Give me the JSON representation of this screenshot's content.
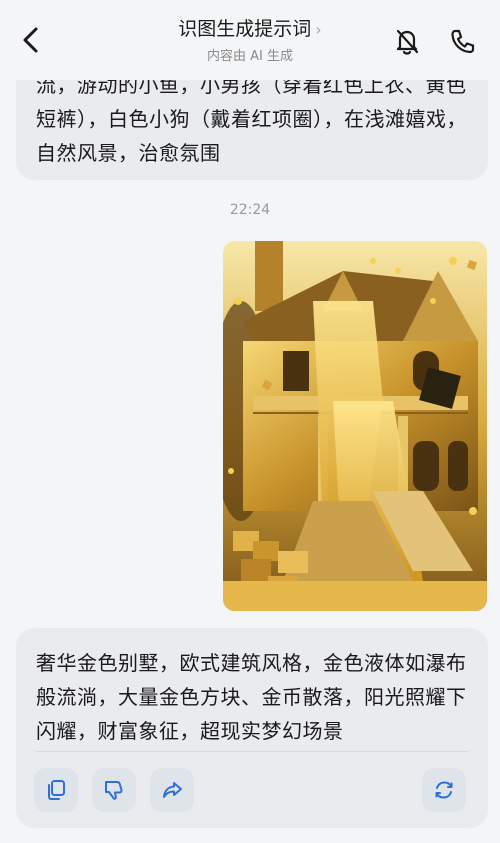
{
  "header": {
    "title": "识图生成提示词",
    "title_chevron": "›",
    "subtitle": "内容由 AI 生成"
  },
  "messages": {
    "top_text": "流，游动的小鱼，小男孩（穿着红色上衣、黄色短裤），白色小狗（戴着红项圈），在浅滩嬉戏，自然风景，治愈氛围",
    "timestamp": "22:24",
    "reply_text": "奢华金色别墅，欧式建筑风格，金色液体如瀑布般流淌，大量金色方块、金币散落，阳光照耀下闪耀，财富象征，超现实梦幻场景"
  },
  "actions": [
    "copy-icon",
    "dislike-icon",
    "share-icon",
    "regenerate-icon"
  ],
  "colors": {
    "accent": "#2f6fd6",
    "bubble": "#e9ebef",
    "background": "#f4f5f7"
  }
}
